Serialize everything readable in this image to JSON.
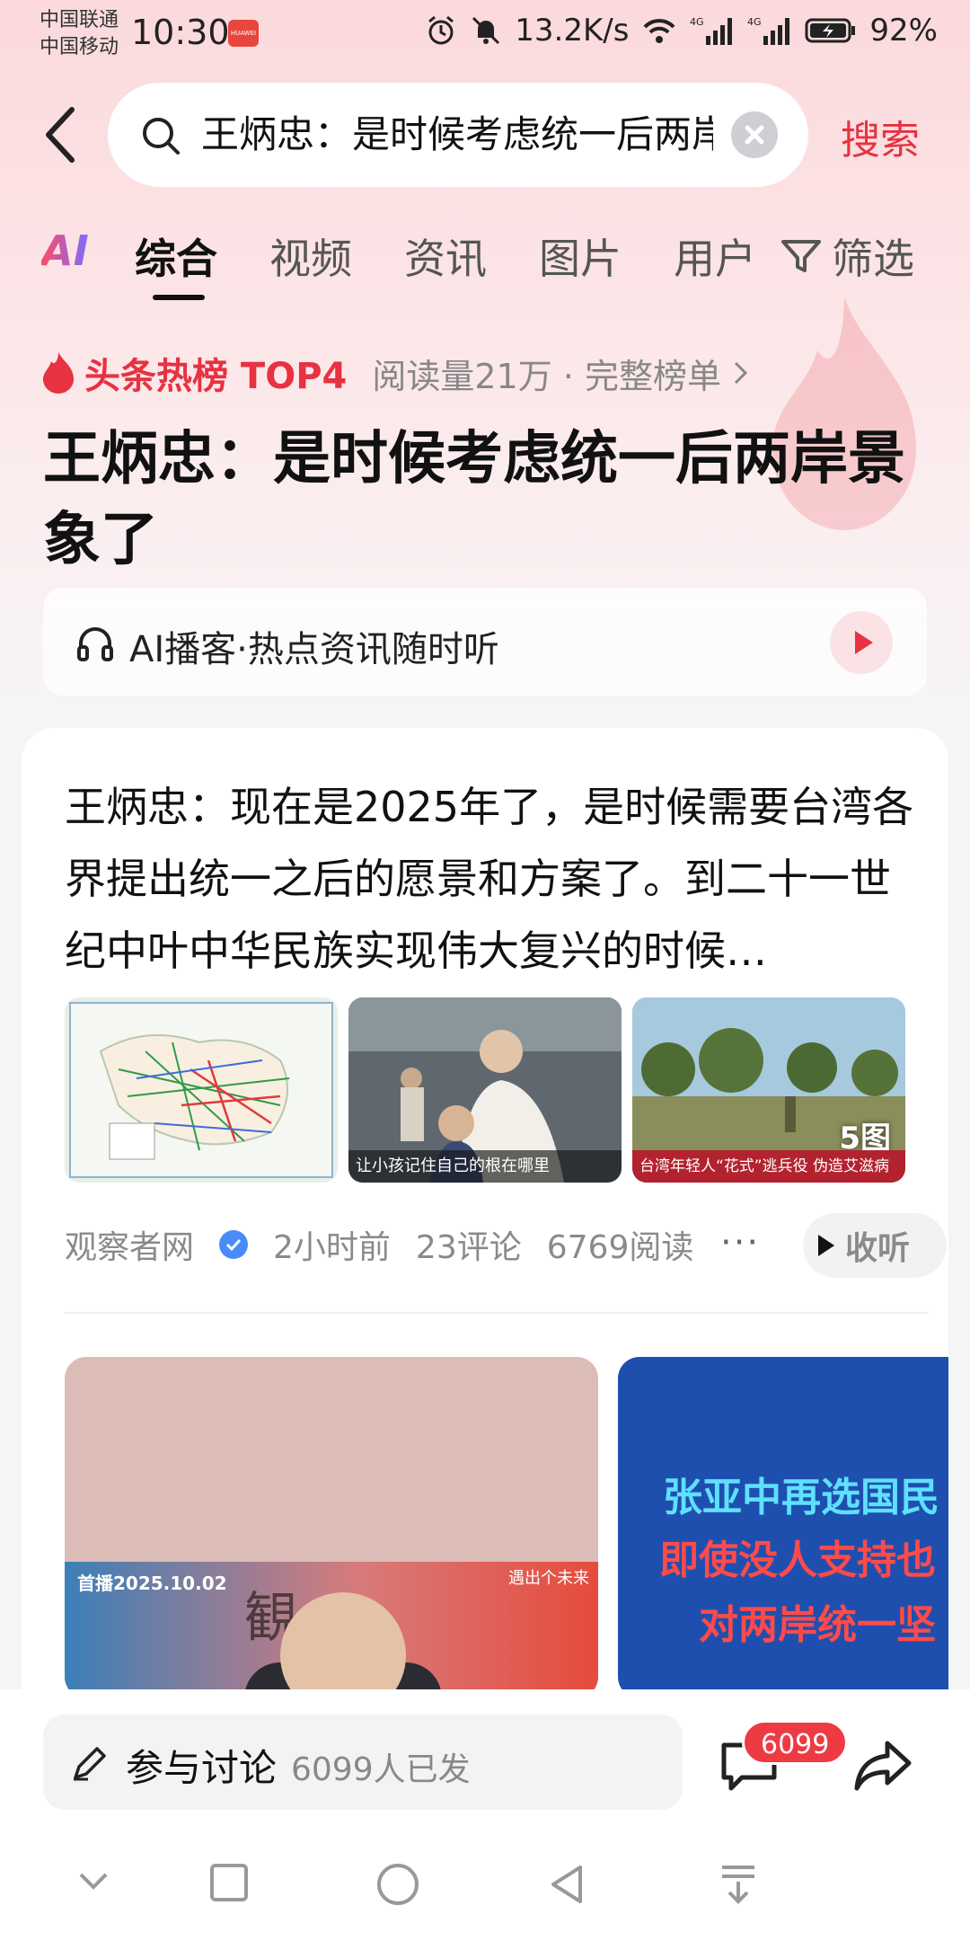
{
  "status": {
    "carrier1": "中国联通",
    "carrier2": "中国移动",
    "time": "10:30",
    "network_speed": "13.2K/s",
    "signal1": "4G",
    "signal2": "4G",
    "battery": "92%"
  },
  "search": {
    "query": "王炳忠：是时候考虑统一后两岸景象了",
    "button": "搜索"
  },
  "tabs": [
    "AI",
    "综合",
    "视频",
    "资讯",
    "图片",
    "用户"
  ],
  "filter_label": "筛选",
  "hot": {
    "title": "头条热榜 TOP4",
    "meta": "阅读量21万 · 完整榜单",
    "headline": "王炳忠：是时候考虑统一后两岸景象了"
  },
  "podcast": {
    "label": "AI播客·热点资讯随时听"
  },
  "article": {
    "summary": "王炳忠：现在是2025年了，是时候需要台湾各界提出统一之后的愿景和方案了。到二十一世纪中叶中华民族实现伟大复兴的时候…",
    "thumb2_caption": "让小孩记住自己的根在哪里",
    "thumb3_caption": "台湾年轻人“花式”逃兵役 伪造艾滋病",
    "image_count": "5图",
    "source": "观察者网",
    "time": "2小时前",
    "comments": "23评论",
    "reads": "6769阅读",
    "more": "···",
    "listen": "收听"
  },
  "videos": {
    "v1_tag": "首播2025.10.02",
    "v1_logo": "観",
    "v1_future": "遇出个未来",
    "v2_line1": "张亚中再选国民",
    "v2_line2": "即使没人支持也",
    "v2_line3": "对两岸统一坚"
  },
  "bottom": {
    "discuss_label": "参与讨论",
    "discuss_count": "6099人已发",
    "comment_badge": "6099"
  },
  "colors": {
    "accent": "#e63241",
    "badge": "#ee3a43"
  }
}
